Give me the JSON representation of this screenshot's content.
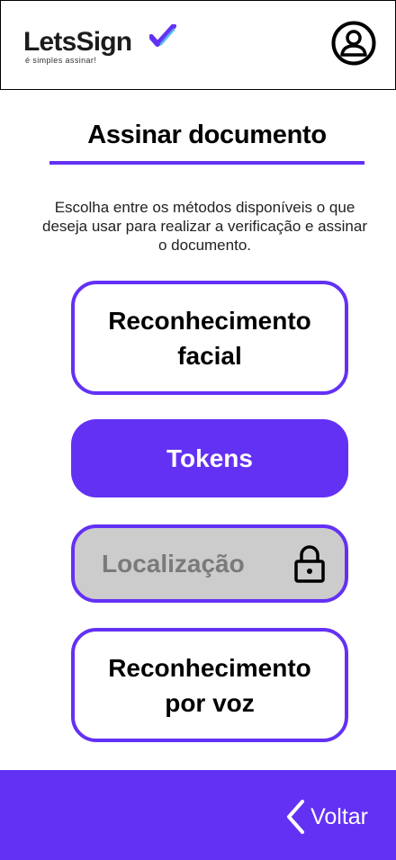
{
  "header": {
    "logo_name": "LetsSign",
    "logo_tagline": "é simples assinar!",
    "avatar_icon": "user-circle-icon"
  },
  "main": {
    "title": "Assinar documento",
    "description": "Escolha entre os métodos disponíveis o que deseja usar para realizar a verificação e assinar o documento.",
    "methods": [
      {
        "label": "Reconhecimento facial",
        "state": "available"
      },
      {
        "label": "Tokens",
        "state": "selected"
      },
      {
        "label": "Localização",
        "state": "locked",
        "icon": "lock-icon"
      },
      {
        "label": "Reconhecimento por voz",
        "state": "available"
      }
    ]
  },
  "footer": {
    "back_label": "Voltar",
    "back_icon": "chevron-left-icon"
  },
  "colors": {
    "accent": "#6331f4",
    "disabled": "#cccccc",
    "disabled_text": "#7a7a7a"
  }
}
